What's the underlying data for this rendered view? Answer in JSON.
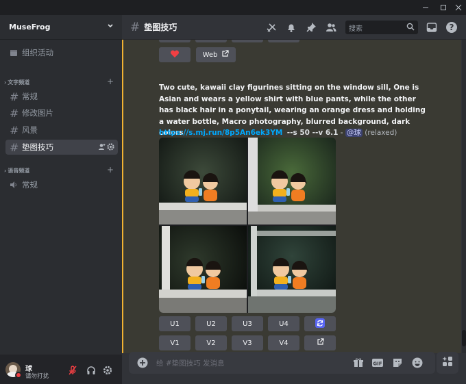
{
  "window": {
    "min_icon": "minimize-icon",
    "max_icon": "maximize-icon",
    "close_icon": "close-icon"
  },
  "server": {
    "name": "MuseFrog"
  },
  "sidebar": {
    "events_label": "组织活动",
    "text_section": "文字频道",
    "text_channels": [
      "常规",
      "修改图片",
      "风景",
      "垫图技巧"
    ],
    "voice_section": "语音频道",
    "voice_channels": [
      "常规"
    ]
  },
  "user": {
    "name": "球",
    "status": "请勿打扰",
    "status_color": "#f23f43"
  },
  "header": {
    "channel": "垫图技巧",
    "search_placeholder": "搜索"
  },
  "message": {
    "web_label": "Web",
    "prompt": "Two cute, kawaii clay figurines sitting on the window sill, One is Asian and wears a yellow shirt with blue pants, while the other has black hair in a ponytail, wearing an orange dress and holding a water bottle, Macro photography, blurred background, dark colors",
    "link": "https://s.mj.run/8p5An6ek3YM",
    "params": "--s 50 --v 6.1",
    "dash": " - ",
    "mention": "@球",
    "mode": "(relaxed)"
  },
  "buttons": {
    "upscale": [
      "U1",
      "U2",
      "U3",
      "U4"
    ],
    "variation": [
      "V1",
      "V2",
      "V3",
      "V4"
    ]
  },
  "composer": {
    "placeholder": "给 #垫图技巧 发消息"
  },
  "colors": {
    "accent": "#5865f2",
    "highlight_border": "#f0b232",
    "heart": "#f23f43"
  }
}
